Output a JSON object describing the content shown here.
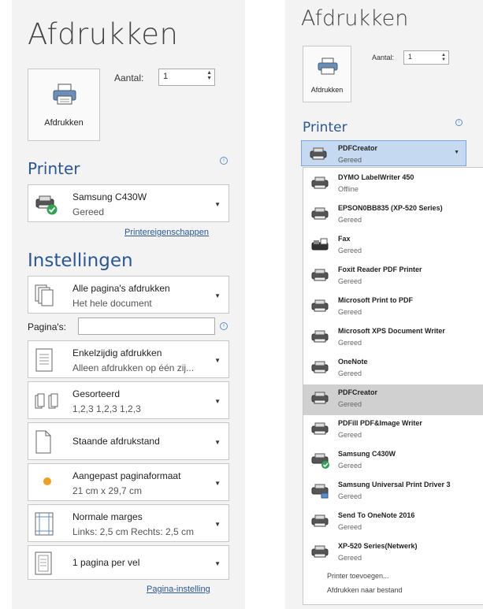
{
  "left": {
    "title": "Afdrukken",
    "print_button_label": "Afdrukken",
    "copies_label": "Aantal:",
    "copies_value": "1",
    "printer_heading": "Printer",
    "printer": {
      "name": "Samsung C430W",
      "status": "Gereed"
    },
    "printer_properties_link": "Printereigenschappen",
    "settings_heading": "Instellingen",
    "settings": [
      {
        "line1": "Alle pagina's afdrukken",
        "line2": "Het hele document"
      },
      {
        "line1": "Enkelzijdig afdrukken",
        "line2": "Alleen afdrukken op één zij..."
      },
      {
        "line1": "Gesorteerd",
        "line2": "1,2,3   1,2,3   1,2,3"
      },
      {
        "line1": "Staande afdrukstand",
        "line2": ""
      },
      {
        "line1": "Aangepast paginaformaat",
        "line2": "21 cm x 29,7 cm"
      },
      {
        "line1": "Normale marges",
        "line2": "Links: 2,5 cm  Rechts: 2,5 cm"
      },
      {
        "line1": "1 pagina per vel",
        "line2": ""
      }
    ],
    "pages_label": "Pagina's:",
    "pages_value": "",
    "page_setup_link": "Pagina-instelling"
  },
  "right": {
    "title": "Afdrukken",
    "print_button_label": "Afdrukken",
    "copies_label": "Aantal:",
    "copies_value": "1",
    "printer_heading": "Printer",
    "selected_printer": {
      "name": "PDFCreator",
      "status": "Gereed"
    },
    "printers": [
      {
        "name": "DYMO LabelWriter 450",
        "status": "Offline",
        "icon": "printer-icon"
      },
      {
        "name": "EPSON0BB835 (XP-520 Series)",
        "status": "Gereed",
        "icon": "printer-icon"
      },
      {
        "name": "Fax",
        "status": "Gereed",
        "icon": "fax-icon"
      },
      {
        "name": "Foxit Reader PDF Printer",
        "status": "Gereed",
        "icon": "printer-icon"
      },
      {
        "name": "Microsoft Print to PDF",
        "status": "Gereed",
        "icon": "printer-icon"
      },
      {
        "name": "Microsoft XPS Document Writer",
        "status": "Gereed",
        "icon": "printer-icon"
      },
      {
        "name": "OneNote",
        "status": "Gereed",
        "icon": "printer-icon"
      },
      {
        "name": "PDFCreator",
        "status": "Gereed",
        "icon": "printer-icon",
        "selected": true
      },
      {
        "name": "PDFill PDF&Image Writer",
        "status": "Gereed",
        "icon": "printer-icon"
      },
      {
        "name": "Samsung C430W",
        "status": "Gereed",
        "icon": "printer-default-icon"
      },
      {
        "name": "Samsung Universal Print Driver 3",
        "status": "Gereed",
        "icon": "network-printer-icon"
      },
      {
        "name": "Send To OneNote 2016",
        "status": "Gereed",
        "icon": "printer-icon"
      },
      {
        "name": "XP-520 Series(Netwerk)",
        "status": "Gereed",
        "icon": "printer-icon"
      }
    ],
    "add_printer_link": "Printer toevoegen...",
    "print_to_file_link": "Afdrukken naar bestand"
  },
  "colors": {
    "accent": "#2b5797",
    "panel_bg": "#f3f3f3",
    "selected_bg": "#c5daf0",
    "check_green": "#2ea44f"
  }
}
